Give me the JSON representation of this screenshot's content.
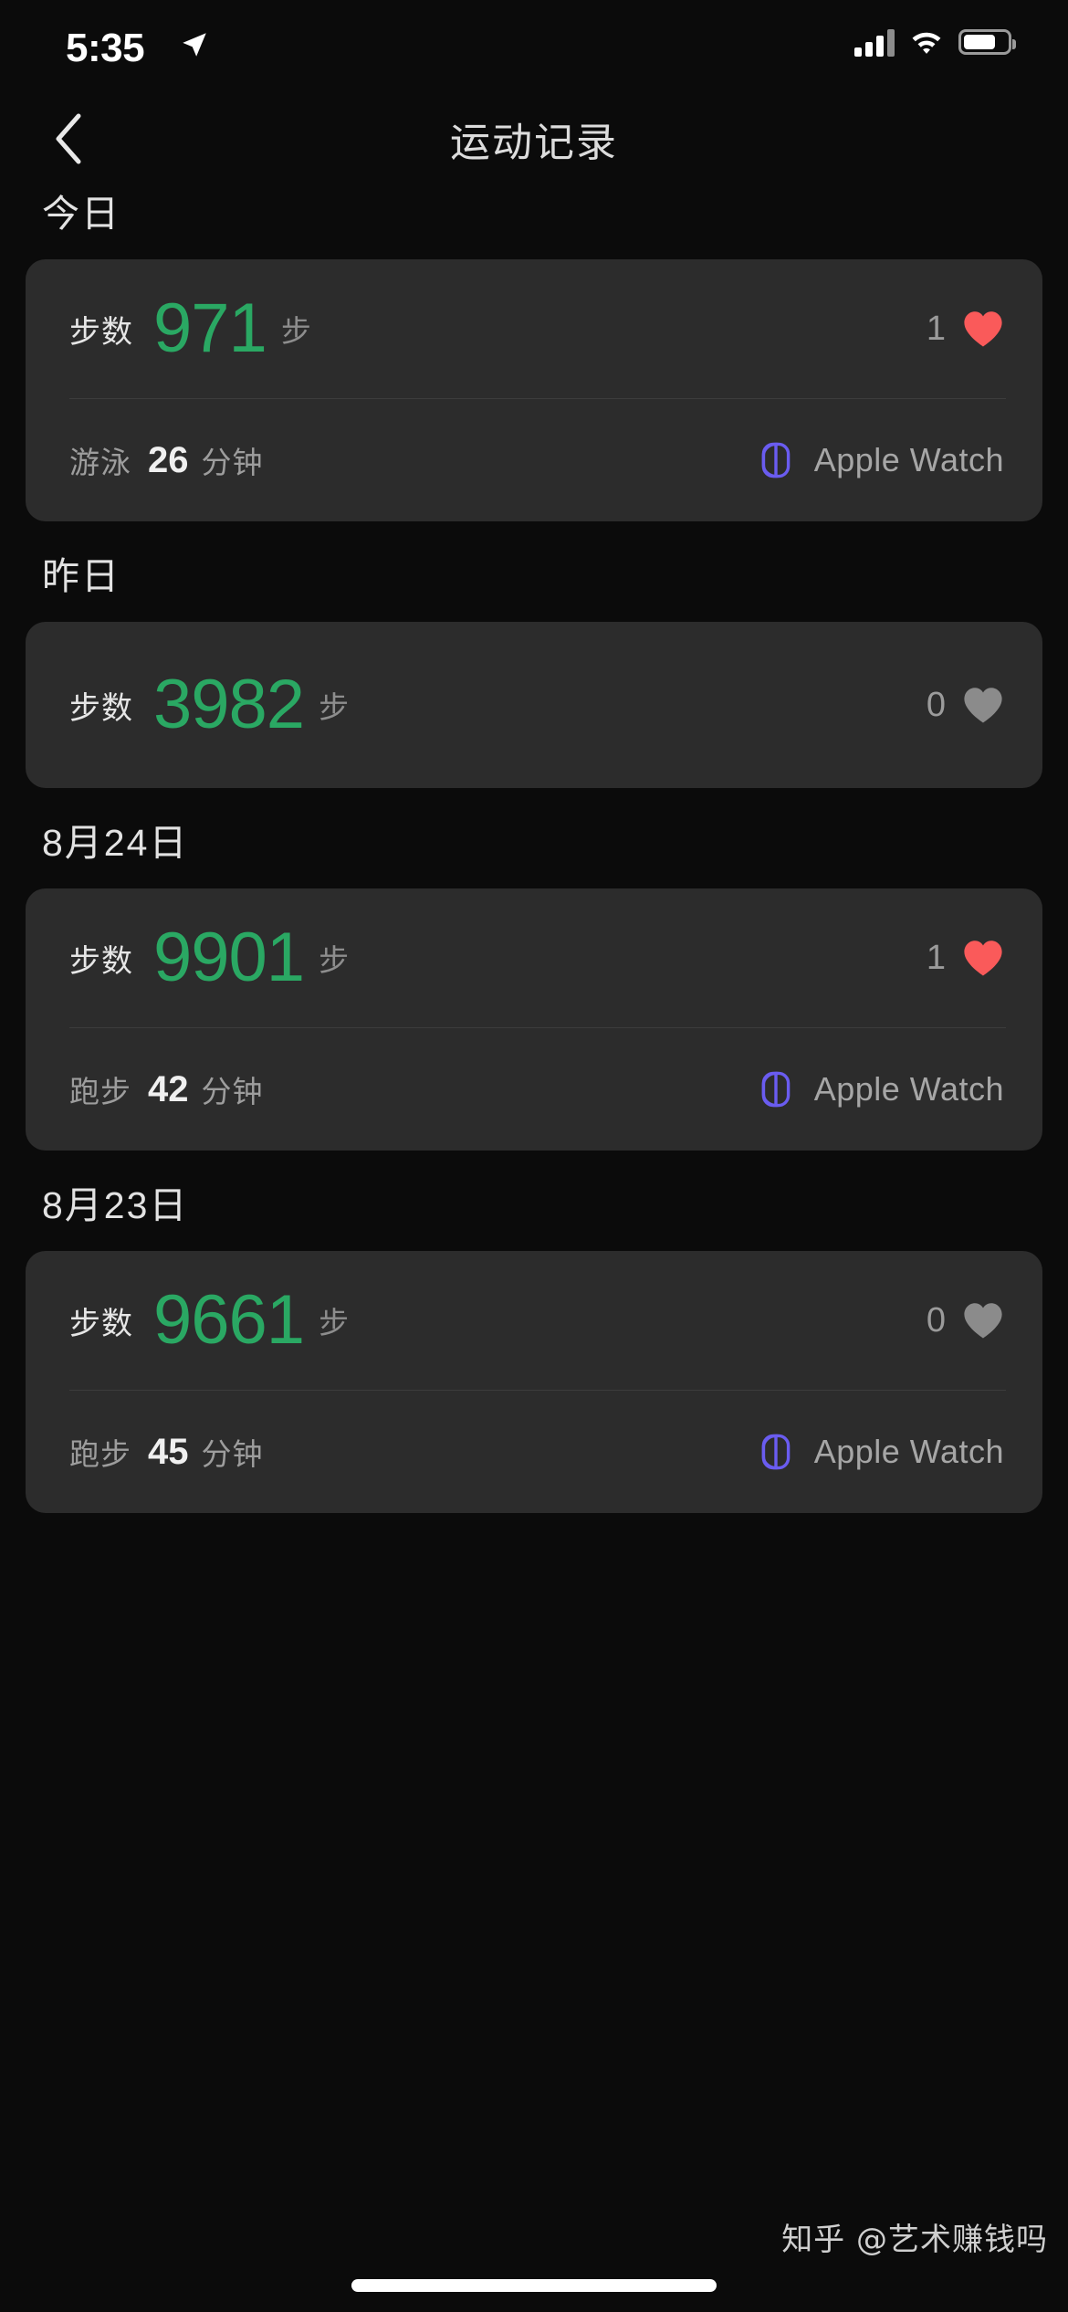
{
  "status_bar": {
    "time": "5:35",
    "location_icon": "location-arrow-icon",
    "cellular_icon": "cellular-signal-icon",
    "wifi_icon": "wifi-icon",
    "battery_icon": "battery-icon"
  },
  "nav": {
    "back_icon": "chevron-left-icon",
    "title": "运动记录"
  },
  "labels": {
    "steps_label": "步数",
    "steps_unit": "步",
    "minutes_unit": "分钟",
    "heart_icon": "heart-icon",
    "watch_icon": "apple-watch-icon"
  },
  "colors": {
    "background": "#0b0b0b",
    "card": "#2c2c2c",
    "steps_green": "#2aa863",
    "heart_active": "#fa5a5a",
    "heart_inactive": "#8b8b8b",
    "watch_purple": "#6a5cf0",
    "text_primary": "#e6e6e6",
    "text_secondary": "#9b9b9b"
  },
  "sections": [
    {
      "title": "今日",
      "steps": {
        "label": "步数",
        "value": "971",
        "unit": "步",
        "like_count": "1",
        "liked": true
      },
      "activity": {
        "type": "游泳",
        "duration": "26",
        "unit": "分钟",
        "source": "Apple Watch"
      }
    },
    {
      "title": "昨日",
      "steps": {
        "label": "步数",
        "value": "3982",
        "unit": "步",
        "like_count": "0",
        "liked": false
      },
      "activity": null
    },
    {
      "title": "8月24日",
      "steps": {
        "label": "步数",
        "value": "9901",
        "unit": "步",
        "like_count": "1",
        "liked": true
      },
      "activity": {
        "type": "跑步",
        "duration": "42",
        "unit": "分钟",
        "source": "Apple Watch"
      }
    },
    {
      "title": "8月23日",
      "steps": {
        "label": "步数",
        "value": "9661",
        "unit": "步",
        "like_count": "0",
        "liked": false
      },
      "activity": {
        "type": "跑步",
        "duration": "45",
        "unit": "分钟",
        "source": "Apple Watch"
      }
    }
  ],
  "watermark": "知乎 @艺术赚钱吗"
}
